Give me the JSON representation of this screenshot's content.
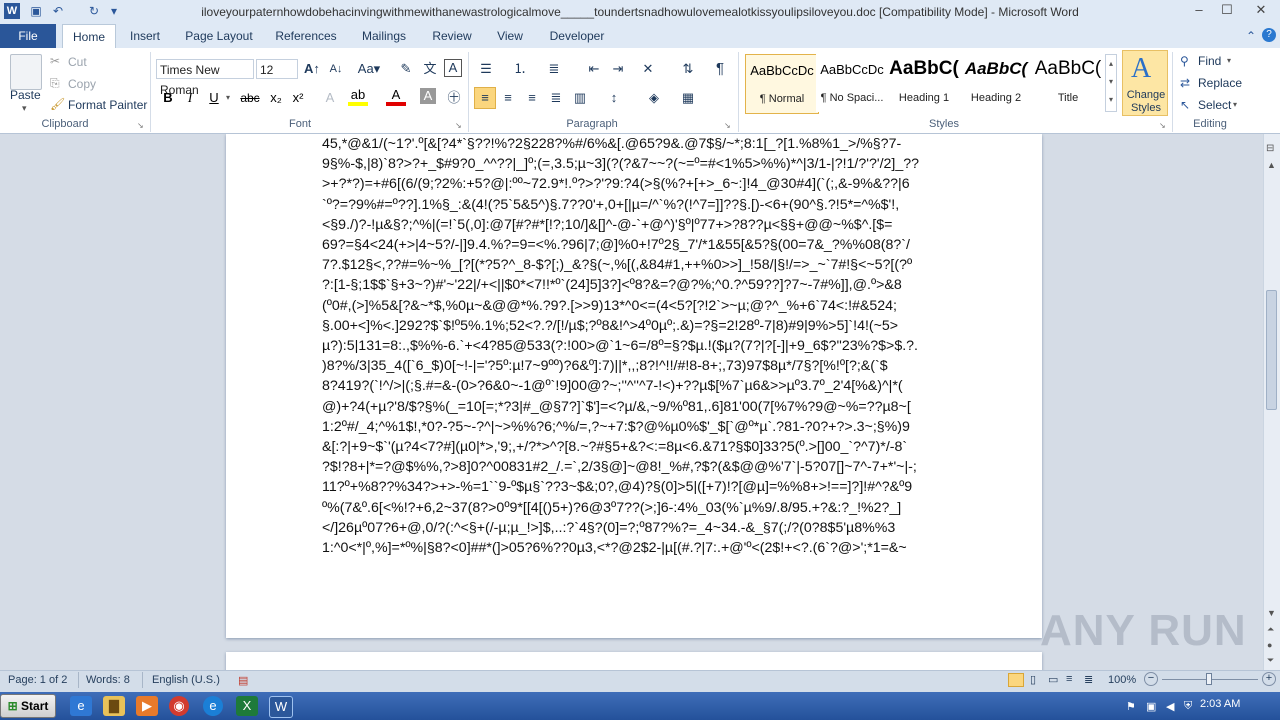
{
  "window": {
    "title": "iloveyourpaternhowdobehacinvingwithmewithanewastrologicalmove_____toundertsnadhowulovemealotkissyoulipsiloveyou.doc [Compatibility Mode]  -  Microsoft Word",
    "minimize": "–",
    "maximize": "☐",
    "close": "✕"
  },
  "tabs": [
    "File",
    "Home",
    "Insert",
    "Page Layout",
    "References",
    "Mailings",
    "Review",
    "View",
    "Developer"
  ],
  "ribbon": {
    "clipboard": {
      "label": "Clipboard",
      "paste": "Paste",
      "cut": "Cut",
      "copy": "Copy",
      "format_painter": "Format Painter"
    },
    "font": {
      "label": "Font",
      "family": "Times New Roman",
      "size": "12",
      "bold": "B",
      "italic": "I",
      "underline": "U",
      "strike": "abc",
      "subscript": "x₂",
      "superscript": "x²"
    },
    "paragraph": {
      "label": "Paragraph",
      "pilcrow": "¶"
    },
    "styles": {
      "label": "Styles",
      "items": [
        {
          "sample": "AaBbCcDc",
          "name": "¶ Normal"
        },
        {
          "sample": "AaBbCcDc",
          "name": "¶ No Spaci..."
        },
        {
          "sample": "AaBbC(",
          "name": "Heading 1"
        },
        {
          "sample": "AaBbC(",
          "name": "Heading 2"
        },
        {
          "sample": "AaBbC(",
          "name": "Title"
        }
      ],
      "change_styles": "Change Styles"
    },
    "editing": {
      "label": "Editing",
      "find": "Find",
      "replace": "Replace",
      "select": "Select"
    }
  },
  "document": {
    "lines": [
      "45,*@&1/(~1?'.º[&[?4*`§??!%?2§228?%#/6%&[.@65?9&.@7$§/~*;8:1[_?[1.%8%1_>/%§?7-",
      "9§%-$,|8)`8?>?+_$#9?0_^^??|_]º;(=,3.5;µ~3](?(?&7~~?(~=º=#<1%5>%%)*^|3/1-|?!1/?'?'/2]_??",
      ">+?*?)=+#6[(6/(9;?2%:+5?@|:ºº~72.9*!.º?>?'?9:?4(>§(%?+[+>_6~:]!4_@30#4](`(;,&-9%&??|6",
      "`º?=?9%#=º??].1%§_:&(4!(?5`5&5^)§.7??0'+,0+[|µ=/^`%?(!^7=]]??§.[)-<6+(90^§.?!5*=^%$'!,",
      "<§9./)?-!µ&§?;^%|(=!`5(,0]:@7[#?#*[!?;10/]&[]^-@-`+@^)'§º|º77+>?8??µ<§§+@@~%$^.[$=",
      "69?=§4<24(+>|4~5?/-|]9.4.%?=9=<%.?96|7;@]%0+!7º2§_7'/*1&55[&5?§(00=7&_?%%08(8?`/",
      "7?.$12§<,??#=%~%_[?[(*?5?^_8-$?[;)_&?§(~,%[(,&84#1,++%0>>]_!58/|§!/=>_~`7#!§<~5?[(?º",
      "?:[1-§;1$$`§+3~?)#'~'22|/+<||$0*<7!!*º`(24]5]3?]<º8?&=?@?%;^0.?^59??]?7~-7#%]],@.º>&8",
      "(º0#,(>]%5&[?&~*$,%0µ~&@@*%.?9?.[>>9)13*^0<=(4<5?[?!2`>~µ;@?^_%+6`74<:!#&524;",
      "§.00+<]%<.]292?$`$!º5%.1%;52<?.?/[!/µ$;?º8&!^>4º0µº;.&)=?§=2!28º-7|8)#9|9%>5]`!4!(~5>",
      "µ?):5|131=8:.,$%%-6.`+<4?85@533(?:!00>@`1~6=/8º=§?$µ.!($µ?(7?|?[-]|+9_6$?''23%?$>$.?.",
      ")8?%/3|35_4([`6_$)0[~!-|='?5º:µ!7~9ºº)?6&º]:7)||*,,;8?!^!!/#!8-8+;,73)97$8µ*/7§?[%!º[?;&(`$",
      "8?419?(`!^/>|(;§.#=&-(0>?6&0~-1@º`!9]00@?~;''^''^7-!<)+??µ$[%7`µ6&>>µº3.7º_2'4[%&)^|*(",
      "@)+?4(+µ?'8/$?§%(_=10[=;*?3|#_@§7?]`$']=<?µ/&,~9/%º81,.6]81'00(7[%7%?9@~%=??µ8~[",
      "1:2º#/_4;^%1$!,*0?-?5~-?^|~>%%?6;^%/=,?~+7:$?@%µ0%$'_$[`@º*µ`.?81-?0?+?>.3~;§%)9",
      "&[:?|+9~$`'(µ?4<7?#](µ0|*>,'9;,+/?*>^?[8.~?#§5+&?<:=8µ<6.&71?§$0]33?5(º.>[]00_`?^7)*/-8`",
      "?$!?8+|*=?@$%%,?>8]0?^00831#2_/.=`,2/3§@]~@8!_%#,?$?(&$@@%'7`|-5?07[]~7^-7+*'~|-;",
      "11?º+%8??%34?>+>-%=1``9-º$µ§`??3~$&;0?,@4)?§(0]>5|([+7)!?[@µ]=%%8+>!==]?]!#^?&º9",
      "º%(7&º.6[<%!?+6,2~37(8?>0º9*[[4[()5+)?6@3º7??(>;]6-:4%_03(%`µ%9/.8/95.+?&:?_!%2?_]",
      "</]26µº07?6+@,0/?(:^<§+(/-µ;µ_!>]$,..:?`4§?(0]=?;º87?%?=_4~34.-&_§7(;/?(0?8$5'µ8%%3",
      "1:^0<*|º,%]=*º%|§8?<0]##*(]>05?6%??0µ3,<*?@2$2-|µ[(#.?|7:.+@'º<(2$!+<?.(6`?@>';*1=&~"
    ]
  },
  "status": {
    "page": "Page: 1 of 2",
    "words": "Words: 8",
    "language": "English (U.S.)",
    "zoom": "100%"
  },
  "taskbar": {
    "start": "Start",
    "time": "2:03 AM"
  },
  "watermark": "ANY RUN"
}
